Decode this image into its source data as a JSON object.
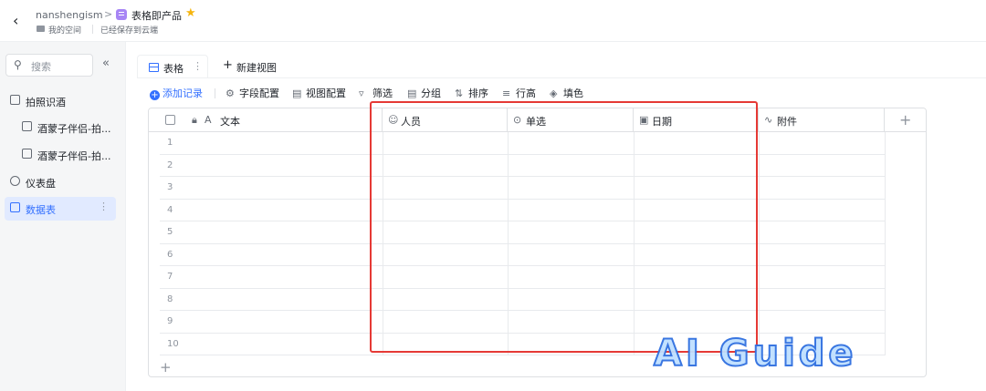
{
  "header": {
    "owner": "nanshengism",
    "title": "表格即产品",
    "space": "我的空间",
    "save_status": "已经保存到云端"
  },
  "sidebar": {
    "search_placeholder": "搜索",
    "items": [
      {
        "label": "拍照识酒"
      },
      {
        "label": "酒蒙子伴侣-拍..."
      },
      {
        "label": "酒蒙子伴侣-拍..."
      },
      {
        "label": "仪表盘"
      },
      {
        "label": "数据表"
      }
    ]
  },
  "tabs": {
    "active": "表格",
    "new_view": "新建视图"
  },
  "toolbar": {
    "add": "添加记录",
    "fields": "字段配置",
    "view": "视图配置",
    "filter": "筛选",
    "group": "分组",
    "sort": "排序",
    "row_height": "行高",
    "fill": "填色"
  },
  "table": {
    "columns": [
      {
        "label": "文本",
        "icon": "text-icon"
      },
      {
        "label": "人员",
        "icon": "person-icon"
      },
      {
        "label": "单选",
        "icon": "single-select-icon"
      },
      {
        "label": "日期",
        "icon": "calendar-icon"
      },
      {
        "label": "附件",
        "icon": "paperclip-icon"
      }
    ],
    "row_numbers": [
      "1",
      "2",
      "3",
      "4",
      "5",
      "6",
      "7",
      "8",
      "9",
      "10"
    ]
  },
  "watermark": "AI Guide",
  "colors": {
    "accent": "#3370ff",
    "highlight": "#e53935",
    "star": "#f5b50f"
  }
}
